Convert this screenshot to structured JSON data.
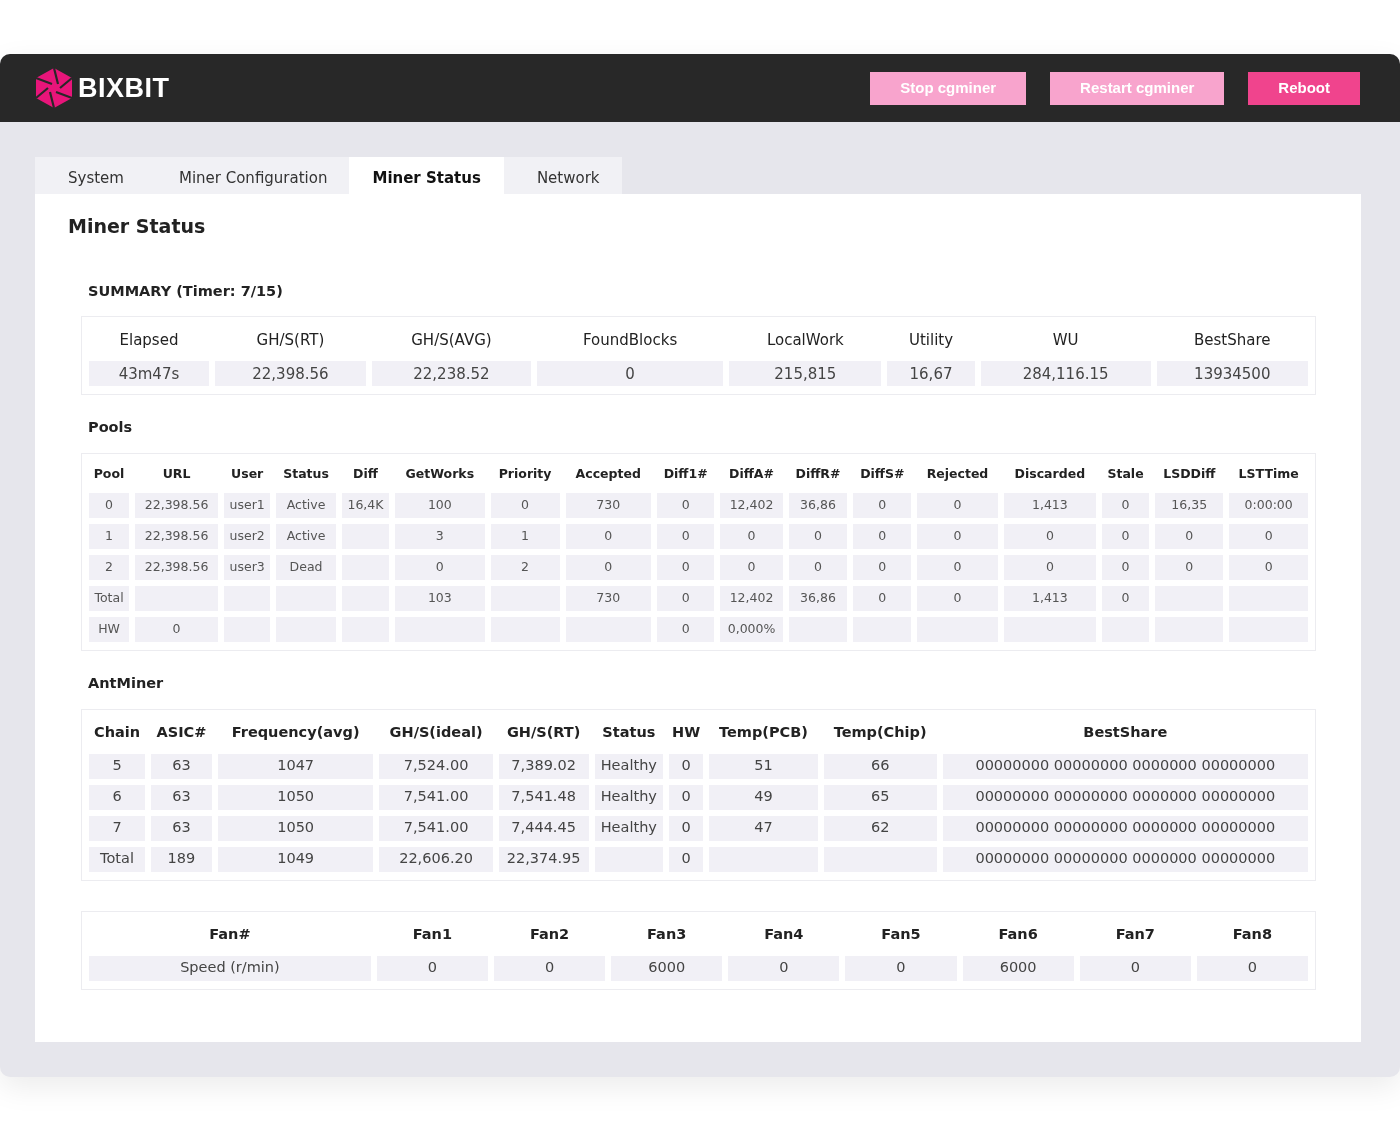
{
  "header": {
    "logo_text": "BIXBIT",
    "buttons": [
      {
        "label": "Stop cgminer",
        "kind": "light"
      },
      {
        "label": "Restart cgminer",
        "kind": "light"
      },
      {
        "label": "Reboot",
        "kind": "strong"
      }
    ]
  },
  "tabs": [
    {
      "label": "System",
      "selected": false
    },
    {
      "label": "Miner Configuration",
      "selected": false
    },
    {
      "label": "Miner Status",
      "selected": true
    },
    {
      "label": "Network",
      "selected": false
    }
  ],
  "page_title": "Miner Status",
  "summary": {
    "title": "SUMMARY (Timer: 7/15)",
    "columns": [
      "Elapsed",
      "GH/S(RT)",
      "GH/S(AVG)",
      "FoundBlocks",
      "LocalWork",
      "Utility",
      "WU",
      "BestShare"
    ],
    "rows": [
      [
        "43m47s",
        "22,398.56",
        "22,238.52",
        "0",
        "215,815",
        "16,67",
        "284,116.15",
        "13934500"
      ]
    ]
  },
  "pools": {
    "title": "Pools",
    "columns": [
      "Pool",
      "URL",
      "User",
      "Status",
      "Diff",
      "GetWorks",
      "Priority",
      "Accepted",
      "Diff1#",
      "DiffA#",
      "DiffR#",
      "DiffS#",
      "Rejected",
      "Discarded",
      "Stale",
      "LSDDiff",
      "LSTTime"
    ],
    "rows": [
      [
        "0",
        "22,398.56",
        "user1",
        "Active",
        "16,4K",
        "100",
        "0",
        "730",
        "0",
        "12,402",
        "36,86",
        "0",
        "0",
        "1,413",
        "0",
        "16,35",
        "0:00:00"
      ],
      [
        "1",
        "22,398.56",
        "user2",
        "Active",
        null,
        "3",
        "1",
        "0",
        "0",
        "0",
        "0",
        "0",
        "0",
        "0",
        "0",
        "0",
        "0"
      ],
      [
        "2",
        "22,398.56",
        "user3",
        "Dead",
        null,
        "0",
        "2",
        "0",
        "0",
        "0",
        "0",
        "0",
        "0",
        "0",
        "0",
        "0",
        "0"
      ],
      [
        "Total",
        null,
        null,
        null,
        null,
        "103",
        null,
        "730",
        "0",
        "12,402",
        "36,86",
        "0",
        "0",
        "1,413",
        "0",
        null,
        null
      ],
      [
        "HW",
        "0",
        null,
        null,
        null,
        null,
        null,
        null,
        "0",
        "0,000%",
        null,
        null,
        null,
        null,
        null,
        null,
        null
      ]
    ]
  },
  "antminer": {
    "title": "AntMiner",
    "columns": [
      "Chain",
      "ASIC#",
      "Frequency(avg)",
      "GH/S(ideal)",
      "GH/S(RT)",
      "Status",
      "HW",
      "Temp(PCB)",
      "Temp(Chip)",
      "BestShare"
    ],
    "rows": [
      [
        "5",
        "63",
        "1047",
        "7,524.00",
        "7,389.02",
        "Healthy",
        "0",
        "51",
        "66",
        "00000000 00000000 0000000 00000000"
      ],
      [
        "6",
        "63",
        "1050",
        "7,541.00",
        "7,541.48",
        "Healthy",
        "0",
        "49",
        "65",
        "00000000 00000000 0000000 00000000"
      ],
      [
        "7",
        "63",
        "1050",
        "7,541.00",
        "7,444.45",
        "Healthy",
        "0",
        "47",
        "62",
        "00000000 00000000 0000000 00000000"
      ],
      [
        "Total",
        "189",
        "1049",
        "22,606.20",
        "22,374.95",
        null,
        "0",
        null,
        null,
        "00000000 00000000 0000000 00000000"
      ]
    ]
  },
  "fans": {
    "columns": [
      "Fan#",
      "Fan1",
      "Fan2",
      "Fan3",
      "Fan4",
      "Fan5",
      "Fan6",
      "Fan7",
      "Fan8"
    ],
    "rows": [
      [
        "Speed (r/min)",
        "0",
        "0",
        "6000",
        "0",
        "0",
        "6000",
        "0",
        "0"
      ]
    ]
  }
}
